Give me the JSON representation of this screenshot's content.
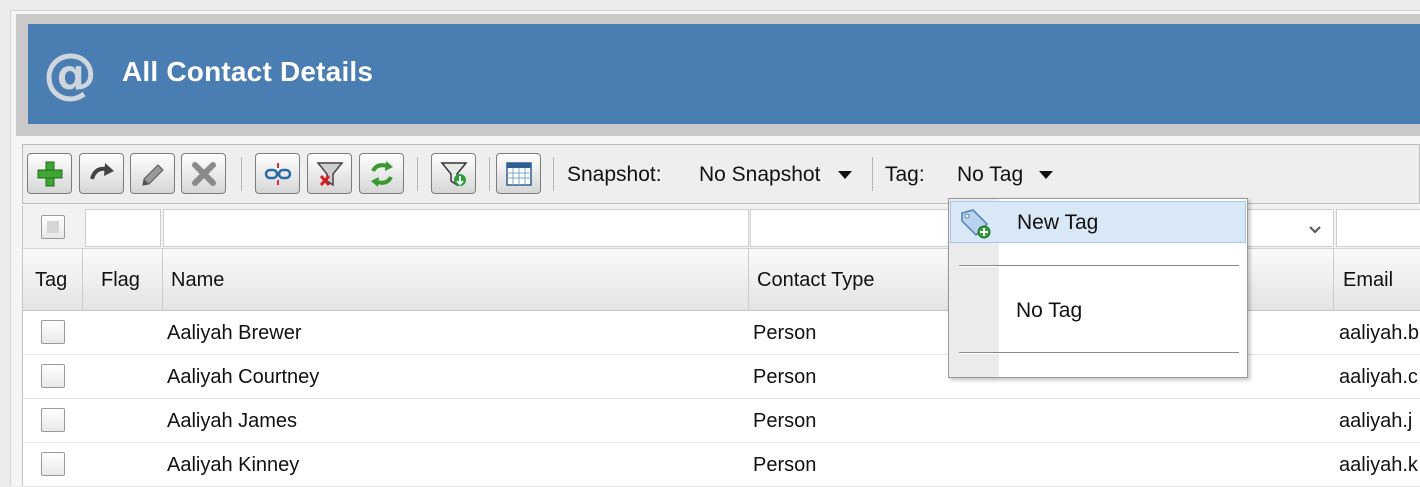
{
  "header": {
    "title": "All Contact Details",
    "icon": "at-sign-icon",
    "background": "#4a7db1"
  },
  "toolbar": {
    "buttons": [
      {
        "name": "add-button",
        "icon": "plus-icon"
      },
      {
        "name": "forward-button",
        "icon": "curved-arrow-icon"
      },
      {
        "name": "edit-button",
        "icon": "pencil-icon"
      },
      {
        "name": "delete-button",
        "icon": "x-icon"
      },
      {
        "name": "unlink-button",
        "icon": "broken-chain-icon"
      },
      {
        "name": "clear-filter-button",
        "icon": "funnel-x-icon"
      },
      {
        "name": "refresh-button",
        "icon": "refresh-icon"
      },
      {
        "name": "filter-button",
        "icon": "funnel-icon"
      },
      {
        "name": "calendar-button",
        "icon": "calendar-icon"
      }
    ],
    "snapshot_label": "Snapshot:",
    "snapshot_value": "No Snapshot",
    "tag_label": "Tag:",
    "tag_value": "No Tag"
  },
  "grid": {
    "columns": [
      "Tag",
      "Flag",
      "Name",
      "Contact Type",
      "Email"
    ],
    "rows": [
      {
        "name": "Aaliyah Brewer",
        "contact_type": "Person",
        "email": "aaliyah.b"
      },
      {
        "name": "Aaliyah Courtney",
        "contact_type": "Person",
        "email": "aaliyah.c"
      },
      {
        "name": "Aaliyah James",
        "contact_type": "Person",
        "email": "aaliyah.j"
      },
      {
        "name": "Aaliyah Kinney",
        "contact_type": "Person",
        "email": "aaliyah.k"
      }
    ]
  },
  "tag_menu": {
    "items": [
      {
        "label": "New Tag",
        "icon": "tag-add-icon",
        "highlighted": true
      },
      {
        "label": "No Tag"
      }
    ]
  }
}
